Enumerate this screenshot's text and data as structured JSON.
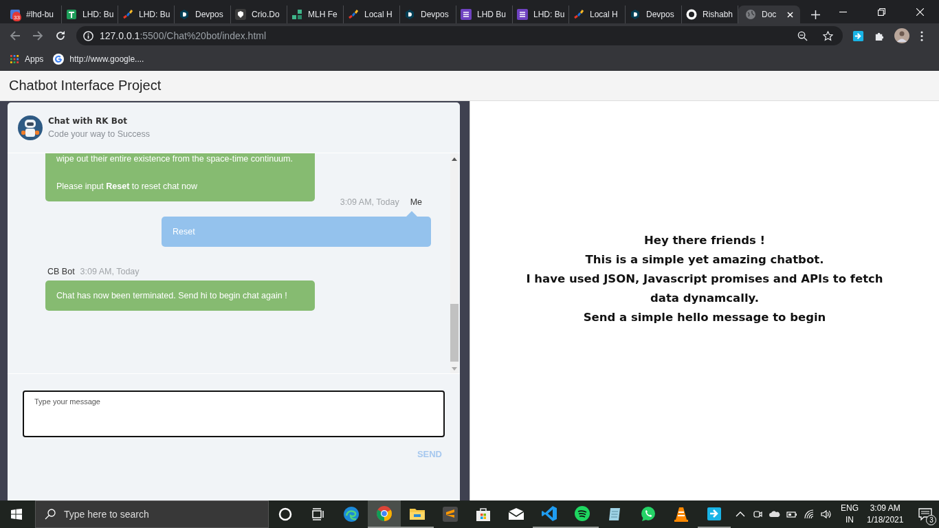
{
  "browser": {
    "tabs": [
      {
        "title": "#lhd-bu",
        "kind": "calendar",
        "selected": false
      },
      {
        "title": "LHD: Bu",
        "kind": "sheet",
        "selected": false
      },
      {
        "title": "LHD: Bu",
        "kind": "mlh",
        "selected": false
      },
      {
        "title": "Devpos",
        "kind": "devpost",
        "selected": false
      },
      {
        "title": "Crio.Do",
        "kind": "crio",
        "selected": false
      },
      {
        "title": "MLH Fe",
        "kind": "blocks",
        "selected": false
      },
      {
        "title": "Local H",
        "kind": "mlh",
        "selected": false
      },
      {
        "title": "Devpos",
        "kind": "devpost",
        "selected": false
      },
      {
        "title": "LHD Bu",
        "kind": "form",
        "selected": false
      },
      {
        "title": "LHD: Bu",
        "kind": "form",
        "selected": false
      },
      {
        "title": "Local H",
        "kind": "mlh",
        "selected": false
      },
      {
        "title": "Devpos",
        "kind": "devpost",
        "selected": false
      },
      {
        "title": "Rishabh",
        "kind": "github",
        "selected": false
      },
      {
        "title": "Doc",
        "kind": "globe",
        "selected": true
      }
    ],
    "tab_badge": "33",
    "url_host": "127.0.0.1",
    "url_path": ":5500/Chat%20bot/index.html",
    "bookmarks": [
      {
        "label": "Apps",
        "kind": "apps"
      },
      {
        "label": "http://www.google....",
        "kind": "google"
      }
    ]
  },
  "page": {
    "title": "Chatbot Interface Project",
    "chat": {
      "name": "Chat with RK Bot",
      "subtitle": "Code your way to Success",
      "messages": [
        {
          "kind": "bot",
          "lines": [
            "wipe out their entire existence from the space-time continuum.",
            "Please input **Reset** to reset chat now"
          ]
        },
        {
          "kind": "user",
          "sender": "Me",
          "time": "3:09 AM, Today",
          "lines": [
            "Reset"
          ]
        },
        {
          "kind": "bot",
          "sender": "CB Bot",
          "time": "3:09 AM, Today",
          "lines": [
            "Chat has now been terminated. Send hi to begin chat again !"
          ]
        }
      ],
      "input": {
        "placeholder": "Type your message"
      },
      "send": "SEND"
    },
    "info": [
      "Hey there friends !",
      "This is a simple yet amazing chatbot.",
      "I have used JSON, Javascript promises and APIs to fetch data dynamcally.",
      "Send a simple hello message to begin"
    ]
  },
  "taskbar": {
    "search_placeholder": "Type here to search",
    "apps": [
      {
        "kind": "cortana",
        "running": false,
        "selected": false
      },
      {
        "kind": "taskview",
        "running": false,
        "selected": false
      },
      {
        "kind": "edge",
        "running": false,
        "selected": false
      },
      {
        "kind": "chrome",
        "running": true,
        "selected": true
      },
      {
        "kind": "explorer",
        "running": true,
        "selected": false
      },
      {
        "kind": "sublime",
        "running": false,
        "selected": false
      },
      {
        "kind": "store",
        "running": false,
        "selected": false
      },
      {
        "kind": "mail",
        "running": false,
        "selected": false
      },
      {
        "kind": "vscode",
        "running": true,
        "selected": false
      },
      {
        "kind": "spotify",
        "running": true,
        "selected": false
      },
      {
        "kind": "notepad",
        "running": false,
        "selected": false
      },
      {
        "kind": "whatsapp",
        "running": false,
        "selected": false
      },
      {
        "kind": "vlc",
        "running": false,
        "selected": false
      },
      {
        "kind": "share",
        "running": true,
        "selected": false
      }
    ],
    "language": "ENG",
    "region": "IN",
    "time": "3:09 AM",
    "date": "1/18/2021",
    "notifications": "3"
  }
}
